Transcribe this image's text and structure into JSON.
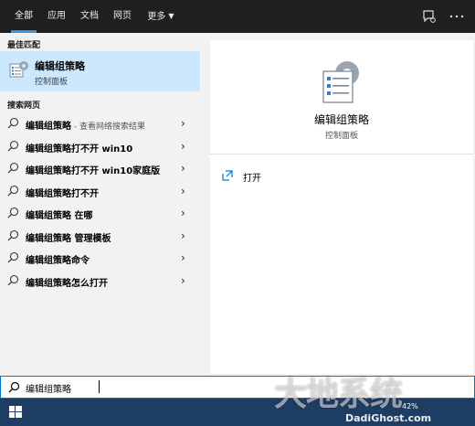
{
  "tabs": [
    {
      "label": "全部"
    },
    {
      "label": "应用"
    },
    {
      "label": "文档"
    },
    {
      "label": "网页"
    },
    {
      "label": "更多"
    }
  ],
  "best_match": {
    "section_title": "最佳匹配",
    "title": "编辑组策略",
    "subtitle": "控制面板"
  },
  "web": {
    "section_title": "搜索网页",
    "items": [
      {
        "bold": "编辑组策略",
        "rest": "",
        "hint": " - 查看网络搜索结果"
      },
      {
        "bold": "编辑组策略打不开 win10",
        "rest": "",
        "hint": ""
      },
      {
        "bold": "编辑组策略打不开 win10家庭版",
        "rest": "",
        "hint": ""
      },
      {
        "bold": "编辑组策略打不开",
        "rest": "",
        "hint": ""
      },
      {
        "bold": "编辑组策略",
        "rest": " 在哪",
        "hint": ""
      },
      {
        "bold": "编辑组策略",
        "rest": " 管理模板",
        "hint": ""
      },
      {
        "bold": "编辑组策略命令",
        "rest": "",
        "hint": ""
      },
      {
        "bold": "编辑组策略怎么打开",
        "rest": "",
        "hint": ""
      }
    ]
  },
  "detail": {
    "app_name": "编辑组策略",
    "app_sub": "控制面板",
    "action_label": "打开"
  },
  "search": {
    "value": "编辑组策略"
  },
  "tray": {
    "battery": "42%",
    "watermark_url": "DadiGhost.com"
  },
  "colors": {
    "topbar": "#1f1f1f",
    "accent": "#0078d7",
    "selected": "#cce8ff",
    "pane": "#f2f2f2",
    "taskbar": "#1e3d63"
  }
}
